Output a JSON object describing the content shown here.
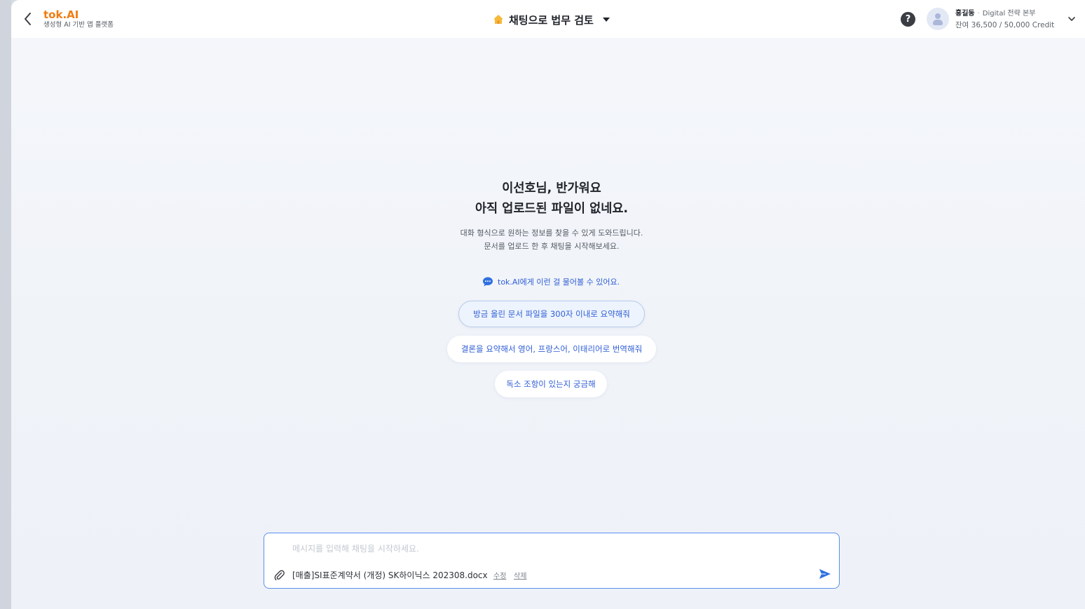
{
  "header": {
    "brand_name": "tok.AI",
    "brand_subtitle": "생성형 AI 기반 앱 플랫폼",
    "mode_label": "채팅으로 법무 검토",
    "help_label": "?",
    "user_name": "홍길동",
    "user_separator": "·",
    "user_dept": "Digital 전략 본부",
    "credit_text": "잔여 36,500 / 50,000 Credit"
  },
  "welcome": {
    "title_line1": "이선호님, 반가워요",
    "title_line2": "아직 업로드된 파일이 없네요.",
    "desc_line1": "대화 형식으로 원하는 정보를 찾을 수 있게 도와드립니다.",
    "desc_line2": "문서를 업로드 한 후 채팅을 시작해보세요."
  },
  "hint": {
    "text": "tok.AI에게 이런 걸 물어볼 수 있어요."
  },
  "suggestions": [
    "방금 올린 문서 파일을 300자 이내로 요약해줘",
    "결론을 요약해서 영어, 프랑스어, 이태리어로 번역해줘",
    "독소 조항이 있는지 궁금해"
  ],
  "chat": {
    "placeholder": "메시지를 입력해 채팅을 시작하세요.",
    "value": "",
    "file_name": "[매출]SI표준계약서 (개정) SK하이닉스 202308.docx",
    "edit_label": "수정",
    "delete_label": "삭제"
  },
  "colors": {
    "brand": "#f07c12",
    "accent": "#2f5ed6",
    "input_border": "#5a8ef0"
  },
  "icons": {
    "back": "chevron-left-icon",
    "mode": "home-icon",
    "help": "question-circle-icon",
    "user_menu": "chevron-down-icon",
    "hint": "chat-bubble-icon",
    "attach": "paperclip-icon",
    "send": "send-icon"
  }
}
